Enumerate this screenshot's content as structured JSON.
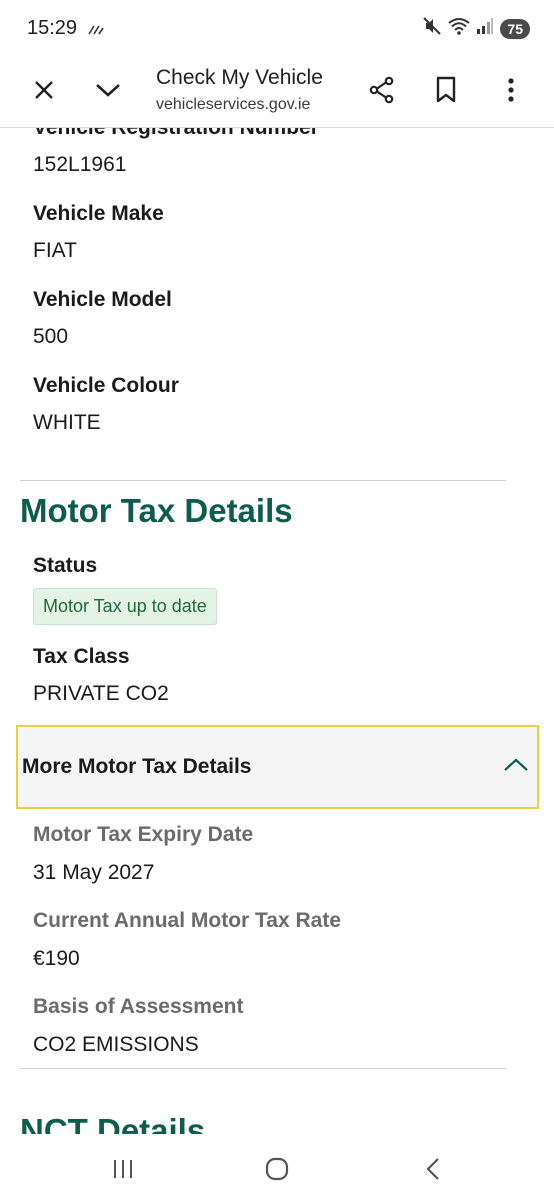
{
  "status_bar": {
    "time": "15:29",
    "battery": "75",
    "icons": [
      "mute-icon",
      "wifi-icon",
      "signal-icon",
      "battery-icon"
    ]
  },
  "toolbar": {
    "title": "Check My Vehicle",
    "url": "vehicleservices.gov.ie",
    "icons": [
      "close-icon",
      "chevron-down-icon",
      "share-icon",
      "bookmark-icon",
      "more-icon"
    ]
  },
  "vehicle": {
    "fields": [
      {
        "label": "Vehicle Registration Number",
        "value": "152L1961"
      },
      {
        "label": "Vehicle Make",
        "value": "FIAT"
      },
      {
        "label": "Vehicle Model",
        "value": "500"
      },
      {
        "label": "Vehicle Colour",
        "value": "WHITE"
      }
    ]
  },
  "motor_tax": {
    "title": "Motor Tax Details",
    "status_label": "Status",
    "status_value": "Motor Tax up to date",
    "tax_class_label": "Tax Class",
    "tax_class_value": "PRIVATE CO2",
    "accordion_label": "More Motor Tax Details",
    "more": [
      {
        "label": "Motor Tax Expiry Date",
        "value": "31 May 2027"
      },
      {
        "label": "Current Annual Motor Tax Rate",
        "value": "€190"
      },
      {
        "label": "Basis of Assessment",
        "value": "CO2 EMISSIONS"
      }
    ]
  },
  "nct": {
    "title": "NCT Details"
  },
  "colors": {
    "heading": "#0d5c4d",
    "tag_bg": "#e3f4e6",
    "focus_outline": "#e8d23a"
  }
}
